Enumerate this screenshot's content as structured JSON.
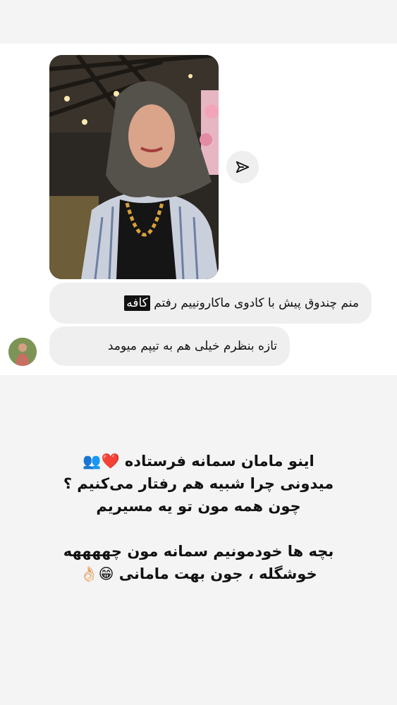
{
  "message": {
    "bubble_1": {
      "text": "منم چندوق پیش با کادوی ماکارونییم رفتم",
      "highlight": "کافه"
    },
    "bubble_2": {
      "text": "تازه بنظرم خیلی هم به تیپم میومد"
    }
  },
  "caption": {
    "line1": "اینو مامان سمانه فرستاده ❤️👥",
    "line2": "میدونی چرا شبیه هم رفتار می‌کنیم ؟",
    "line3": "چون همه مون تو یه مسیریم",
    "line4": "بچه ها خودمونیم سمانه مون چههههه",
    "line5": "خوشگله ، جون بهت مامانی 😁👌🏻"
  },
  "icons": {
    "share": "send-icon"
  },
  "colors": {
    "bubble_bg": "#efefef",
    "card_bg": "#ffffff",
    "page_bg": "#f4f4f4",
    "highlight_bg": "#111111"
  }
}
